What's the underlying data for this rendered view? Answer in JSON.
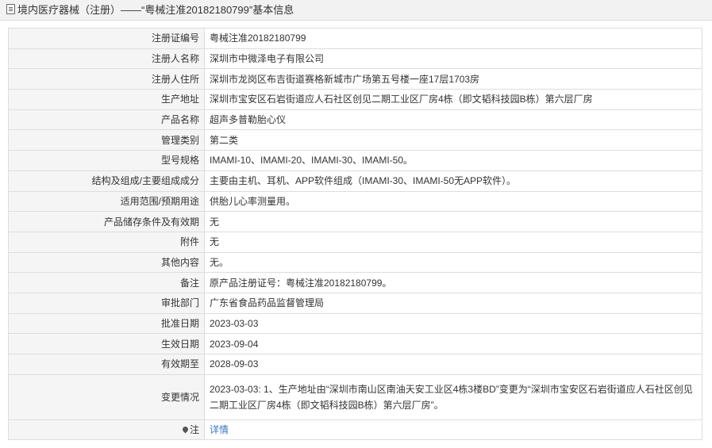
{
  "header": {
    "icon": "document-icon",
    "title": "境内医疗器械（注册）——“粤械注准20182180799”基本信息"
  },
  "rows": [
    {
      "label": "注册证编号",
      "value": "粤械注准20182180799"
    },
    {
      "label": "注册人名称",
      "value": "深圳市中微泽电子有限公司"
    },
    {
      "label": "注册人住所",
      "value": "深圳市龙岗区布吉街道赛格新城市广场第五号楼一座17层1703房"
    },
    {
      "label": "生产地址",
      "value": "深圳市宝安区石岩街道应人石社区创见二期工业区厂房4栋（即文韬科技园B栋）第六层厂房"
    },
    {
      "label": "产品名称",
      "value": "超声多普勒胎心仪"
    },
    {
      "label": "管理类别",
      "value": "第二类"
    },
    {
      "label": "型号规格",
      "value": "IMAMI-10、IMAMI-20、IMAMI-30、IMAMI-50。"
    },
    {
      "label": "结构及组成/主要组成成分",
      "value": "主要由主机、耳机、APP软件组成（IMAMI-30、IMAMI-50无APP软件）。"
    },
    {
      "label": "适用范围/预期用途",
      "value": "供胎儿心率测量用。"
    },
    {
      "label": "产品储存条件及有效期",
      "value": "无"
    },
    {
      "label": "附件",
      "value": "无"
    },
    {
      "label": "其他内容",
      "value": "无。"
    },
    {
      "label": "备注",
      "value": "原产品注册证号：粤械注准20182180799。"
    },
    {
      "label": "审批部门",
      "value": "广东省食品药品监督管理局"
    },
    {
      "label": "批准日期",
      "value": "2023-03-03"
    },
    {
      "label": "生效日期",
      "value": "2023-09-04"
    },
    {
      "label": "有效期至",
      "value": "2028-09-03"
    },
    {
      "label": "变更情况",
      "value": "2023-03-03: 1、生产地址由“深圳市南山区南油天安工业区4栋3楼BD”变更为“深圳市宝安区石岩街道应人石社区创见二期工业区厂房4栋（即文韬科技园B栋）第六层厂房”。"
    }
  ],
  "note": {
    "icon": "location-pin-icon",
    "label": "注",
    "link_text": "详情"
  },
  "colors": {
    "link": "#3a78c2",
    "label_bg": "#f5f5f5",
    "border": "#dddddd",
    "header_bg": "#f2f2f2"
  }
}
